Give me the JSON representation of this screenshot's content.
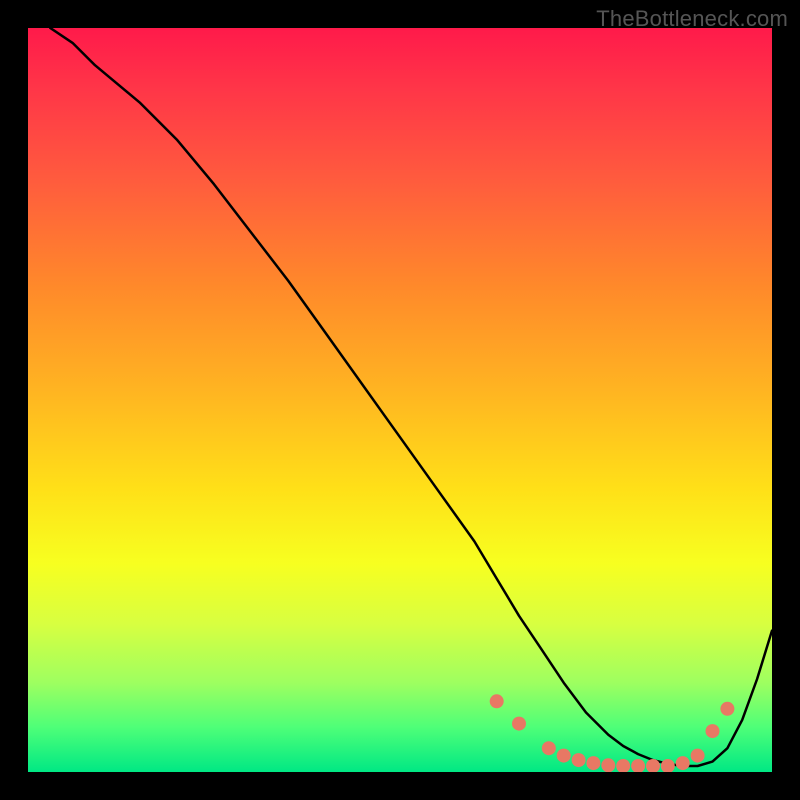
{
  "watermark": "TheBottleneck.com",
  "chart_data": {
    "type": "line",
    "title": "",
    "xlabel": "",
    "ylabel": "",
    "xlim": [
      0,
      100
    ],
    "ylim": [
      0,
      100
    ],
    "series": [
      {
        "name": "curve",
        "x": [
          3,
          6,
          9,
          12,
          15,
          20,
          25,
          30,
          35,
          40,
          45,
          50,
          55,
          60,
          63,
          66,
          69,
          72,
          75,
          78,
          80,
          82,
          84,
          86,
          88,
          90,
          92,
          94,
          96,
          98,
          100
        ],
        "values": [
          100,
          98,
          95,
          92.5,
          90,
          85,
          79,
          72.5,
          66,
          59,
          52,
          45,
          38,
          31,
          26,
          21,
          16.5,
          12,
          8,
          5,
          3.5,
          2.4,
          1.6,
          1.1,
          0.8,
          0.8,
          1.4,
          3.2,
          7,
          12.5,
          19
        ]
      }
    ],
    "markers": {
      "name": "highlight-points",
      "color": "#e87864",
      "x": [
        63,
        66,
        70,
        72,
        74,
        76,
        78,
        80,
        82,
        84,
        86,
        88,
        90,
        92,
        94
      ],
      "values": [
        9.5,
        6.5,
        3.2,
        2.2,
        1.6,
        1.2,
        0.9,
        0.8,
        0.8,
        0.8,
        0.8,
        1.2,
        2.2,
        5.5,
        8.5
      ]
    }
  }
}
